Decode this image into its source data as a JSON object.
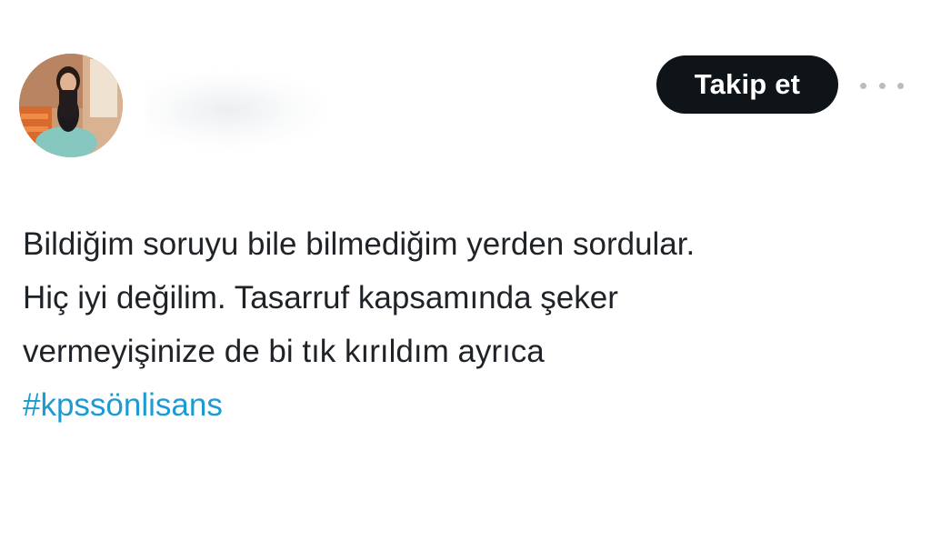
{
  "user": {
    "avatar_icon": "profile-photo"
  },
  "follow_button": {
    "label": "Takip et"
  },
  "more_button": {
    "icon": "more-horizontal-icon"
  },
  "tweet": {
    "lines": [
      "Bildiğim soruyu bile bilmediğim yerden sordular.",
      "Hiç iyi değilim. Tasarruf kapsamında şeker",
      "vermeyişinize de bi tık kırıldım ayrıca"
    ],
    "hashtag": "#kpssönlisans"
  },
  "colors": {
    "button_bg": "#0f1419",
    "button_text": "#ffffff",
    "text": "#1f2328",
    "link": "#1d9bd0",
    "icon_gray": "#b6bdc3"
  }
}
